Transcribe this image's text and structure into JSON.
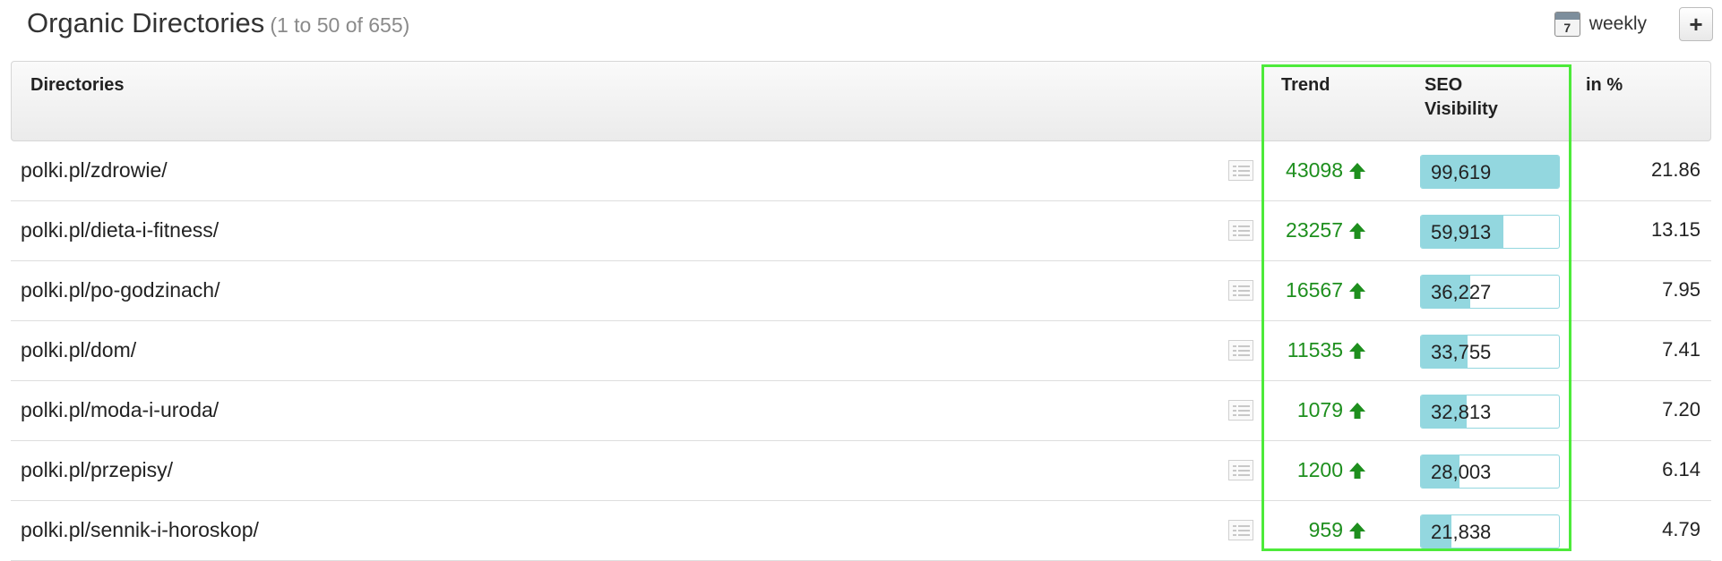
{
  "header": {
    "title": "Organic Directories",
    "range": "(1 to 50 of 655)",
    "interval_label": "weekly",
    "calendar_day": "7",
    "add_label": "+"
  },
  "columns": {
    "directories": "Directories",
    "trend": "Trend",
    "seo_visibility": "SEO Visibility",
    "in_percent": "in %"
  },
  "rows": [
    {
      "directory": "polki.pl/zdrowie/",
      "trend": "43098",
      "visibility": "99,619",
      "visibility_fraction": 1.0,
      "percent": "21.86"
    },
    {
      "directory": "polki.pl/dieta-i-fitness/",
      "trend": "23257",
      "visibility": "59,913",
      "visibility_fraction": 0.6,
      "percent": "13.15"
    },
    {
      "directory": "polki.pl/po-godzinach/",
      "trend": "16567",
      "visibility": "36,227",
      "visibility_fraction": 0.36,
      "percent": "7.95"
    },
    {
      "directory": "polki.pl/dom/",
      "trend": "11535",
      "visibility": "33,755",
      "visibility_fraction": 0.34,
      "percent": "7.41"
    },
    {
      "directory": "polki.pl/moda-i-uroda/",
      "trend": "1079",
      "visibility": "32,813",
      "visibility_fraction": 0.33,
      "percent": "7.20"
    },
    {
      "directory": "polki.pl/przepisy/",
      "trend": "1200",
      "visibility": "28,003",
      "visibility_fraction": 0.28,
      "percent": "6.14"
    },
    {
      "directory": "polki.pl/sennik-i-horoskop/",
      "trend": "959",
      "visibility": "21,838",
      "visibility_fraction": 0.22,
      "percent": "4.79"
    }
  ],
  "colors": {
    "trend_up": "#1e8f1e",
    "bar_fill": "#93d7df",
    "highlight": "#4dea3a"
  },
  "icons": {
    "calendar": "calendar-icon",
    "add": "plus-icon",
    "trend": "arrow-up-icon",
    "detail": "list-detail-icon"
  }
}
